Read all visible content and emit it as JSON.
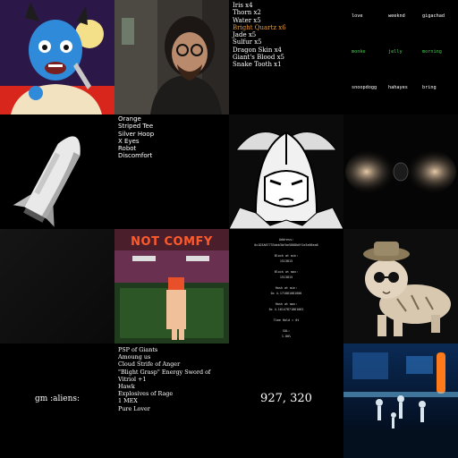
{
  "inventory_1": {
    "items": [
      "Iris x4",
      "Thorn x2",
      "Water x5",
      "Bright Quartz x6",
      "Jade x5",
      "Sulfur x5",
      "Dragon Skin x4",
      "Giant's Blood x5",
      "Snake Tooth x1"
    ],
    "highlight_index": 3,
    "highlight_color": "#e89a3a"
  },
  "word_grid": {
    "rows": [
      [
        {
          "text": "love",
          "color": "#ffffff"
        },
        {
          "text": "weeknd",
          "color": "#ffffff"
        },
        {
          "text": "gigachad",
          "color": "#ffffff"
        }
      ],
      [
        {
          "text": "monke",
          "color": "#3fd24a"
        },
        {
          "text": "jelly",
          "color": "#3fd24a"
        },
        {
          "text": "morning",
          "color": "#3fd24a"
        }
      ],
      [
        {
          "text": "snoopdogg",
          "color": "#ffffff"
        },
        {
          "text": "hahayes",
          "color": "#ffffff"
        },
        {
          "text": "bring",
          "color": "#ffffff"
        }
      ]
    ]
  },
  "traits": {
    "items": [
      "Orange",
      "Striped Tee",
      "Silver Hoop",
      "X Eyes",
      "Robot",
      "Discomfort"
    ]
  },
  "comfy": {
    "title": "NOT COMFY",
    "title_color": "#ff5a2a"
  },
  "address_card": {
    "lines": [
      "Address:",
      "0x1D3A67733deb3bfbe5808b0f1e3e06ea6",
      "Block at min:",
      "1513815",
      "Block at max:",
      "1513815",
      "Hash at min:",
      "0x 4.171881081606",
      "Hash at max:",
      "0x 4.16147871861062",
      "Time Hold = 0t",
      "SOL:",
      "1.00%"
    ]
  },
  "gm_tile": {
    "text": "gm :aliens:"
  },
  "inventory_2": {
    "items": [
      "PSP of Giants",
      "Amoung us",
      "Cloud Strife of Anger",
      "\"Blight Grasp\" Energy Sword of Vitriol +1",
      "Hawk",
      "Explosives of Rage",
      "1 MEX",
      "Pure Lover"
    ]
  },
  "coords_tile": {
    "text": "927, 320"
  }
}
